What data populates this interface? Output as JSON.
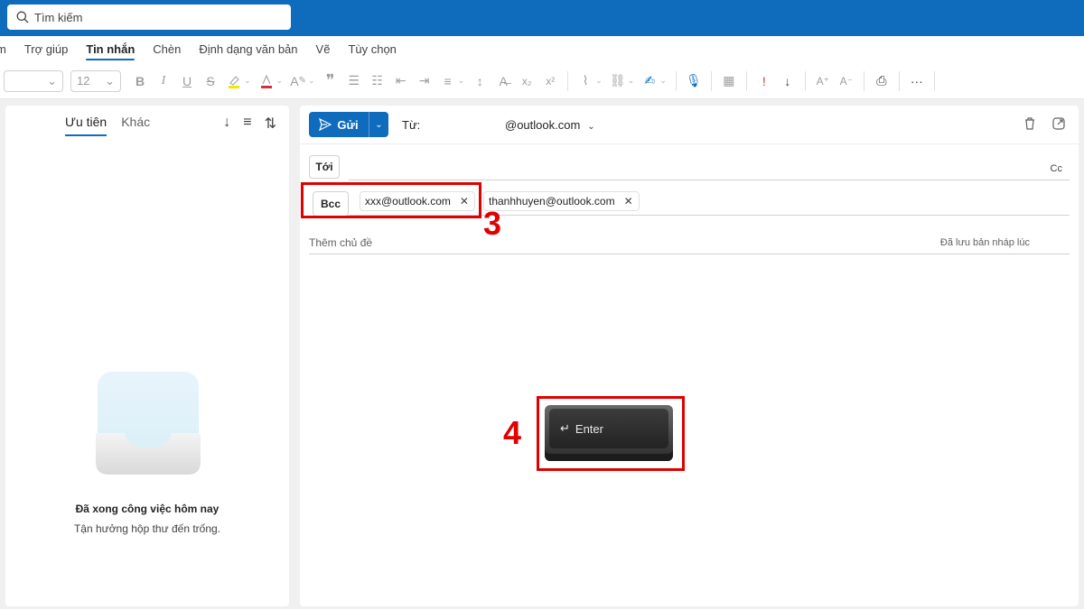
{
  "search": {
    "placeholder": "Tìm kiếm"
  },
  "ribbon": {
    "tabs": [
      {
        "label": "m"
      },
      {
        "label": "Trợ giúp"
      },
      {
        "label": "Tin nhắn"
      },
      {
        "label": "Chèn"
      },
      {
        "label": "Định dạng văn bản"
      },
      {
        "label": "Vẽ"
      },
      {
        "label": "Tùy chọn"
      }
    ],
    "active_tab": "Tin nhắn"
  },
  "toolbar": {
    "font_size": "12",
    "bold": "B",
    "italic": "I",
    "underline": "U",
    "strike": "S"
  },
  "left_panel": {
    "tabs": [
      {
        "label": "Ưu tiên"
      },
      {
        "label": "Khác"
      }
    ],
    "empty_title": "Đã xong công việc hôm nay",
    "empty_subtitle": "Tận hưởng hộp thư đến trống."
  },
  "compose": {
    "send_label": "Gửi",
    "from_label": "Từ:",
    "from_value": "@outlook.com",
    "to_label": "Tới",
    "cc_label": "Cc",
    "bcc_label": "Bcc",
    "bcc_recipients": [
      {
        "email": "xxx@outlook.com"
      },
      {
        "email": "thanhhuyen@outlook.com"
      }
    ],
    "subject_placeholder": "Thêm chủ đề",
    "draft_status": "Đã lưu bản nháp lúc"
  },
  "annotations": {
    "step3": "3",
    "step4": "4",
    "enter_key_label": "Enter"
  },
  "colors": {
    "brand": "#0f6cbd",
    "annotation": "#e00000"
  }
}
